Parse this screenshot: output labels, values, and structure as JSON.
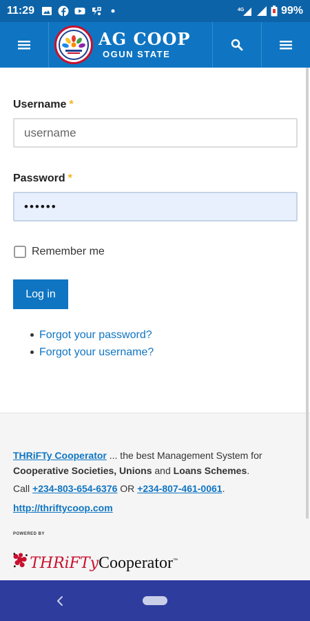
{
  "status_bar": {
    "time": "11:29",
    "network": "4G",
    "battery": "99%"
  },
  "header": {
    "brand_title": "AG COOP",
    "brand_subtitle": "OGUN STATE",
    "logo_icon": "coop-logo-icon",
    "menu_left_icon": "hamburger-icon",
    "search_icon": "search-icon",
    "menu_right_icon": "hamburger-icon"
  },
  "form": {
    "username_label": "Username",
    "required_mark": "*",
    "username_placeholder": "username",
    "username_value": "",
    "password_label": "Password",
    "password_value": "••••••",
    "remember_label": "Remember me",
    "remember_checked": false,
    "login_button": "Log in",
    "links": [
      "Forgot your password?",
      "Forgot your username?"
    ]
  },
  "footer": {
    "brand_name": "THRiFTy Cooperator",
    "tagline_a": " ... the best Management System for ",
    "bold_1": "Cooperative Societies, Unions",
    "and_text": " and ",
    "bold_2": "Loans Schemes",
    "period": ".",
    "call_label": "Call ",
    "phone_1": "+234-803-654-6376",
    "or_text": " OR ",
    "phone_2": "+234-807-461-0061",
    "period2": ".",
    "website": "http://thriftycoop.com",
    "powered_by": "POWERED BY",
    "logo_text_1": "THRiFTy",
    "logo_text_2": "Cooperator",
    "logo_tm": "™"
  },
  "colors": {
    "primary": "#0f75c2",
    "status_bar": "#0d63a8",
    "nav_bar": "#2e3c9e",
    "required": "#f1b51c"
  }
}
